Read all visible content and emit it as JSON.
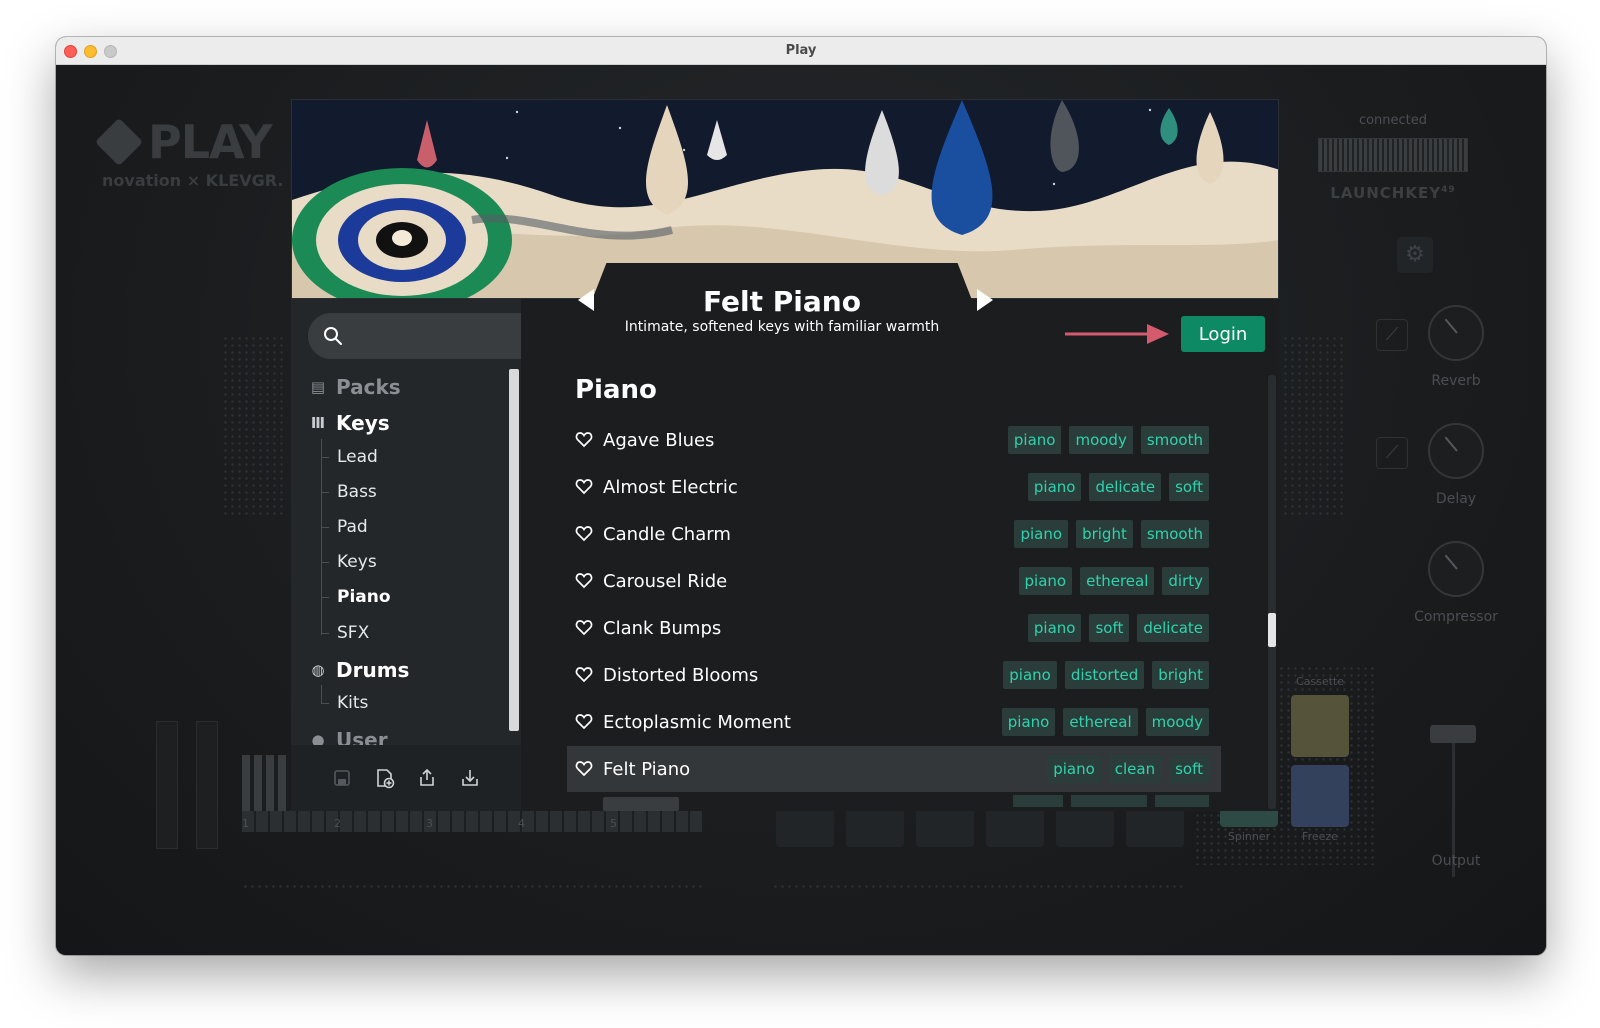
{
  "window": {
    "title": "Play"
  },
  "brand": {
    "logo_text": "PLAY",
    "sublogo_text": "novation × KLEVGR."
  },
  "device": {
    "status": "connected",
    "name": "LAUNCHKEY",
    "model_suffix": "49"
  },
  "effects": {
    "reverb_label": "Reverb",
    "delay_label": "Delay",
    "compressor_label": "Compressor",
    "output_label": "Output",
    "pads": [
      {
        "label": "Cassette",
        "color": "#7b7a4e"
      },
      {
        "label": "Spinner",
        "color": "#5e8f86"
      },
      {
        "label": "Freeze",
        "color": "#4e5f82"
      }
    ]
  },
  "keyboard": {
    "octave_labels": [
      "1",
      "2",
      "3",
      "4",
      "5"
    ]
  },
  "search": {
    "placeholder": "",
    "value": ""
  },
  "sidebar": {
    "sections": [
      {
        "label": "Packs",
        "icon": "packs-icon"
      },
      {
        "label": "Keys",
        "icon": "keys-icon"
      },
      {
        "label": "Drums",
        "icon": "drums-icon"
      },
      {
        "label": "User",
        "icon": "user-icon"
      }
    ],
    "keys_items": [
      "Lead",
      "Bass",
      "Pad",
      "Keys",
      "Piano",
      "SFX"
    ],
    "drums_items": [
      "Kits"
    ],
    "active_item": "Piano",
    "toolbar_icons": [
      "save-icon",
      "new-preset-icon",
      "export-icon",
      "import-icon"
    ]
  },
  "preset": {
    "name": "Felt Piano",
    "description": "Intimate, softened keys with familiar warmth",
    "prev_icon": "triangle-left-icon",
    "next_icon": "triangle-right-icon"
  },
  "login": {
    "label": "Login"
  },
  "category": {
    "title": "Piano"
  },
  "presets": [
    {
      "name": "Agave Blues",
      "tags": [
        "piano",
        "moody",
        "smooth"
      ]
    },
    {
      "name": "Almost Electric",
      "tags": [
        "piano",
        "delicate",
        "soft"
      ]
    },
    {
      "name": "Candle Charm",
      "tags": [
        "piano",
        "bright",
        "smooth"
      ]
    },
    {
      "name": "Carousel Ride",
      "tags": [
        "piano",
        "ethereal",
        "dirty"
      ]
    },
    {
      "name": "Clank Bumps",
      "tags": [
        "piano",
        "soft",
        "delicate"
      ]
    },
    {
      "name": "Distorted Blooms",
      "tags": [
        "piano",
        "distorted",
        "bright"
      ]
    },
    {
      "name": "Ectoplasmic Moment",
      "tags": [
        "piano",
        "ethereal",
        "moody"
      ]
    },
    {
      "name": "Felt Piano",
      "tags": [
        "piano",
        "clean",
        "soft"
      ],
      "selected": true
    }
  ],
  "colors": {
    "accent_green": "#0d8a63",
    "tag_text": "#2ed3ad",
    "tag_bg": "#2b3d3b",
    "pointer_arrow": "#d45b6e"
  }
}
